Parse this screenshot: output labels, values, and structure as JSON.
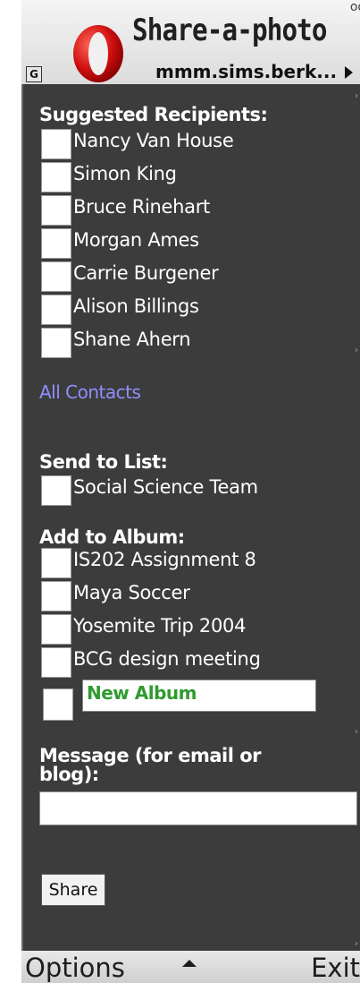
{
  "titlebar": {
    "title": "Share-a-photo",
    "url": "mmm.sims.berk...",
    "indicator": "G",
    "signal": "oo"
  },
  "recipients": {
    "heading": "Suggested Recipients:",
    "items": [
      "Nancy Van House",
      "Simon King",
      "Bruce Rinehart",
      "Morgan Ames",
      "Carrie Burgener",
      "Alison Billings",
      "Shane Ahern"
    ],
    "all_contacts": "All Contacts"
  },
  "send_list": {
    "heading": "Send to List:",
    "items": [
      "Social Science Team"
    ]
  },
  "album": {
    "heading": "Add to Album:",
    "items": [
      "IS202 Assignment 8",
      "Maya Soccer",
      "Yosemite Trip 2004",
      "BCG design meeting"
    ],
    "new_album_value": "New Album"
  },
  "message": {
    "heading": "Message (for email or blog):",
    "value": ""
  },
  "share_label": "Share",
  "softkeys": {
    "left": "Options",
    "right": "Exit"
  },
  "colors": {
    "content_bg": "#3c3c3c",
    "link": "#8f8fff",
    "new_album_text": "#2e9b2e"
  }
}
